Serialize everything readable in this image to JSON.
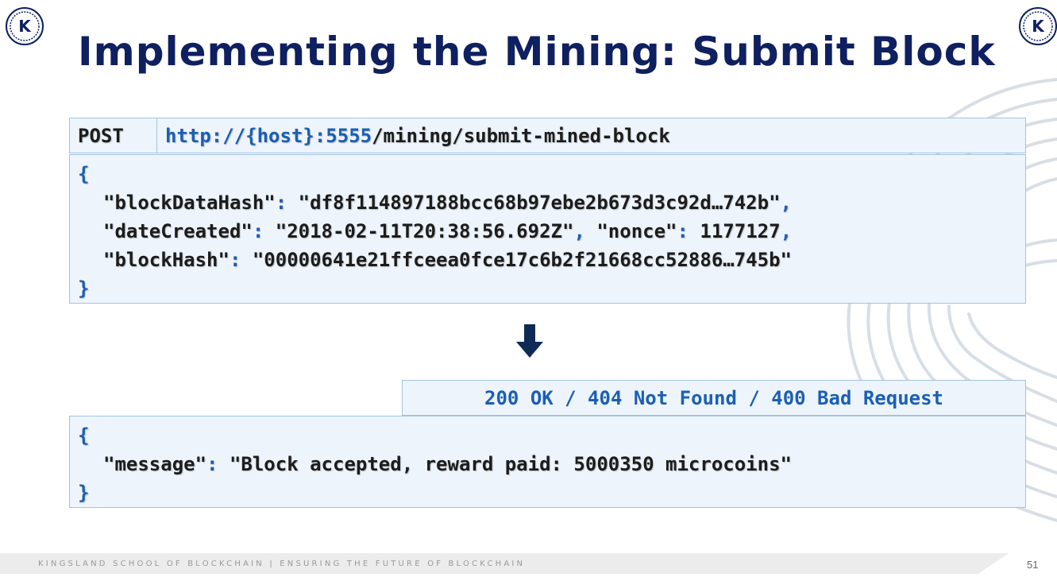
{
  "slide": {
    "title": "Implementing the Mining: Submit Block",
    "logo_letter": "K",
    "page_number": "51"
  },
  "request": {
    "method": "POST",
    "url_prefix": "http://{host}:5555",
    "url_path": "/mining/submit-mined-block",
    "open_brace": "{",
    "close_brace": "}",
    "fields": {
      "blockDataHash_key": "\"blockDataHash\"",
      "blockDataHash_value": "\"df8f114897188bcc68b97ebe2b673d3c92d…742b\"",
      "dateCreated_key": "\"dateCreated\"",
      "dateCreated_value": "\"2018-02-11T20:38:56.692Z\"",
      "nonce_key": "\"nonce\"",
      "nonce_value": "1177127",
      "blockHash_key": "\"blockHash\"",
      "blockHash_value": "\"00000641e21ffceea0fce17c6b2f21668cc52886…745b\""
    }
  },
  "response": {
    "status": "200 OK / 404 Not Found / 400 Bad Request",
    "open_brace": "{",
    "close_brace": "}",
    "message_key": "\"message\"",
    "message_value": "\"Block accepted, reward paid: 5000350 microcoins\""
  },
  "footer": {
    "text": "KINGSLAND SCHOOL OF BLOCKCHAIN | ENSURING THE FUTURE OF BLOCKCHAIN"
  },
  "colors": {
    "title": "#0f2060",
    "accent_blue": "#1a5fb4",
    "box_bg": "#eef4fb",
    "box_border": "#9fc4e0",
    "arrow": "#0f2a55"
  },
  "icons": {
    "logo": "kingsland-k-logo",
    "arrow": "down-arrow-icon",
    "background": "fingerprint-watermark"
  }
}
